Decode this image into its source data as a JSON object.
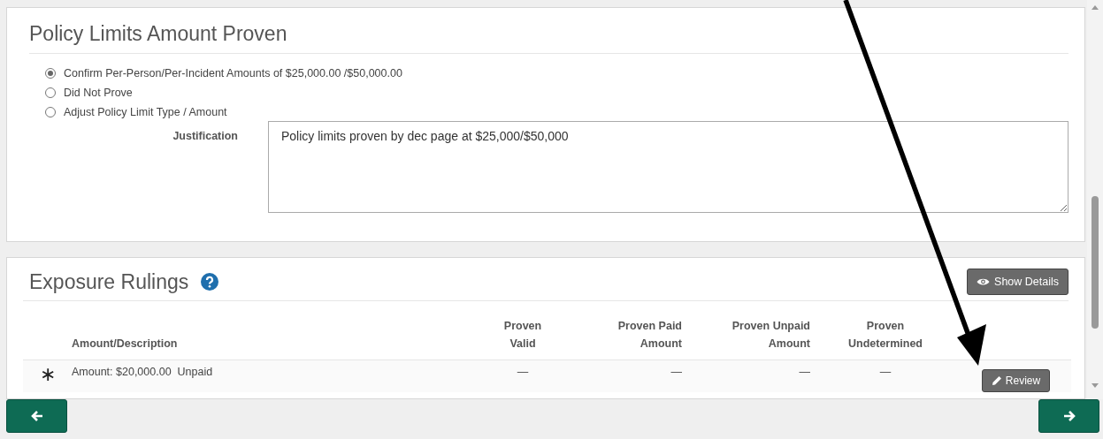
{
  "policy_limits": {
    "title": "Policy Limits Amount Proven",
    "options": [
      {
        "label": "Confirm Per-Person/Per-Incident Amounts of $25,000.00 /$50,000.00",
        "selected": true
      },
      {
        "label": "Did Not Prove",
        "selected": false
      },
      {
        "label": "Adjust Policy Limit Type / Amount",
        "selected": false
      }
    ],
    "justification": {
      "label": "Justification",
      "value": "Policy limits proven by dec page at $25,000/$50,000"
    }
  },
  "exposure_rulings": {
    "title": "Exposure Rulings",
    "show_details_button": "Show Details",
    "columns": [
      "",
      "Amount/Description",
      "Proven Valid",
      "Proven Paid Amount",
      "Proven Unpaid Amount",
      "Proven Undetermined"
    ],
    "rows": [
      {
        "cells": [
          "∗",
          "Amount: $20,000.00  Unpaid",
          "—",
          "—",
          "—",
          "—"
        ],
        "action": "Review"
      }
    ]
  }
}
